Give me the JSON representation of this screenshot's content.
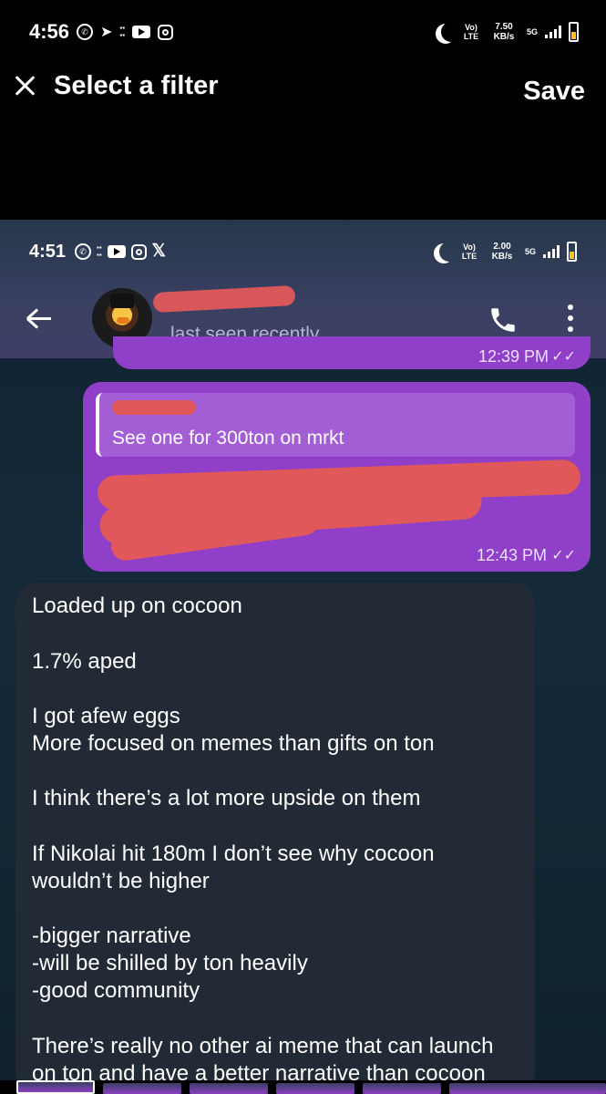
{
  "status_bar": {
    "time": "4:56",
    "network": "Vo) LTE",
    "speed": "7.50 KB/s",
    "signal_label": "5G"
  },
  "filter_header": {
    "title": "Select a filter",
    "save_label": "Save"
  },
  "inner_status_bar": {
    "time": "4:51",
    "network": "Vo) LTE",
    "speed": "2.00 KB/s",
    "signal_label": "5G"
  },
  "chat_header": {
    "status": "last seen recently"
  },
  "messages": {
    "prev_time": "12:39 PM",
    "reply_quote": "See one for 300ton on mrkt",
    "reply_time": "12:43 PM",
    "incoming_lines": [
      "Loaded up on cocoon",
      "1.7% aped",
      "I got afew eggs",
      "More focused on memes than gifts on ton",
      "I think there’s a lot more upside on them",
      "If Nikolai hit 180m I don’t see why cocoon",
      "wouldn’t be higher",
      "-bigger narrative",
      "-will be shilled by ton heavily",
      "-good community",
      "There’s really no other ai meme that can launch",
      "on ton and have a better narrative than cocoon"
    ]
  },
  "colors": {
    "accent_purple": "#9040c8",
    "redaction": "#e0585a",
    "incoming_bubble": "#222a35"
  }
}
